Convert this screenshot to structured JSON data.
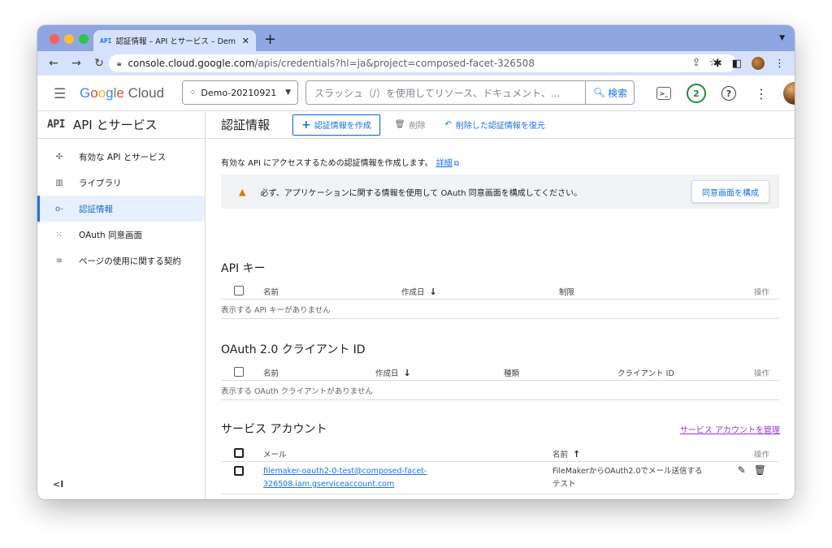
{
  "browser": {
    "tab_prefix": "API",
    "tab_title": "認証情報 – API とサービス – Dem",
    "close_glyph": "✕",
    "newtab_glyph": "+",
    "url_host": "console.cloud.google.com",
    "url_path": "/apis/credentials?hl=ja&project=composed-facet-326508"
  },
  "header": {
    "logo_parts": [
      "G",
      "o",
      "o",
      "g",
      "l",
      "e",
      " Cloud"
    ],
    "project": "Demo-20210921",
    "search_placeholder": "スラッシュ（/）を使用してリソース、ドキュメント、...",
    "search_button": "検索",
    "notification_count": "2",
    "terminal_glyph": ">_",
    "help_glyph": "?"
  },
  "sidebar": {
    "title_mark": "API",
    "title": "API とサービス",
    "items": [
      {
        "label": "有効な API とサービス",
        "icon": "api-services-icon",
        "glyph": "✣",
        "active": false
      },
      {
        "label": "ライブラリ",
        "icon": "library-icon",
        "glyph": "▥",
        "active": false
      },
      {
        "label": "認証情報",
        "icon": "key-icon",
        "glyph": "o-",
        "active": true
      },
      {
        "label": "OAuth 同意画面",
        "icon": "consent-icon",
        "glyph": "⁙",
        "active": false
      },
      {
        "label": "ページの使用に関する契約",
        "icon": "agreement-icon",
        "glyph": "≡",
        "active": false
      }
    ],
    "collapse_glyph": "<I"
  },
  "toolbar": {
    "page_title": "認証情報",
    "create_label": "認証情報を作成",
    "delete_label": "削除",
    "restore_label": "削除した認証情報を復元"
  },
  "intro": {
    "text": "有効な API にアクセスするための認証情報を作成します。",
    "link": "詳細"
  },
  "alert": {
    "text": "必ず、アプリケーションに関する情報を使用して OAuth 同意画面を構成してください。",
    "button": "同意画面を構成"
  },
  "api_keys": {
    "title": "API キー",
    "columns": [
      "名前",
      "作成日",
      "制限",
      "操作"
    ],
    "empty": "表示する API キーがありません"
  },
  "oauth": {
    "title": "OAuth 2.0 クライアント ID",
    "columns": [
      "名前",
      "作成日",
      "種類",
      "クライアント ID",
      "操作"
    ],
    "empty": "表示する OAuth クライアントがありません"
  },
  "service_accounts": {
    "title": "サービス アカウント",
    "manage_link": "サービス アカウントを管理",
    "columns": [
      "メール",
      "名前",
      "操作"
    ],
    "rows": [
      {
        "email_line1": "filemaker-oauth2-0-test@composed-facet-",
        "email_line2": "326508.iam.gserviceaccount.com",
        "name_line1": "FileMakerからOAuth2.0でメール送信する",
        "name_line2": "テスト"
      }
    ]
  },
  "colors": {
    "accent": "#1a73e8",
    "tab_strip": "#8ea7e2",
    "toolbar": "#d6e2fb",
    "warning": "#e37400",
    "visited_link": "#9334e6"
  }
}
